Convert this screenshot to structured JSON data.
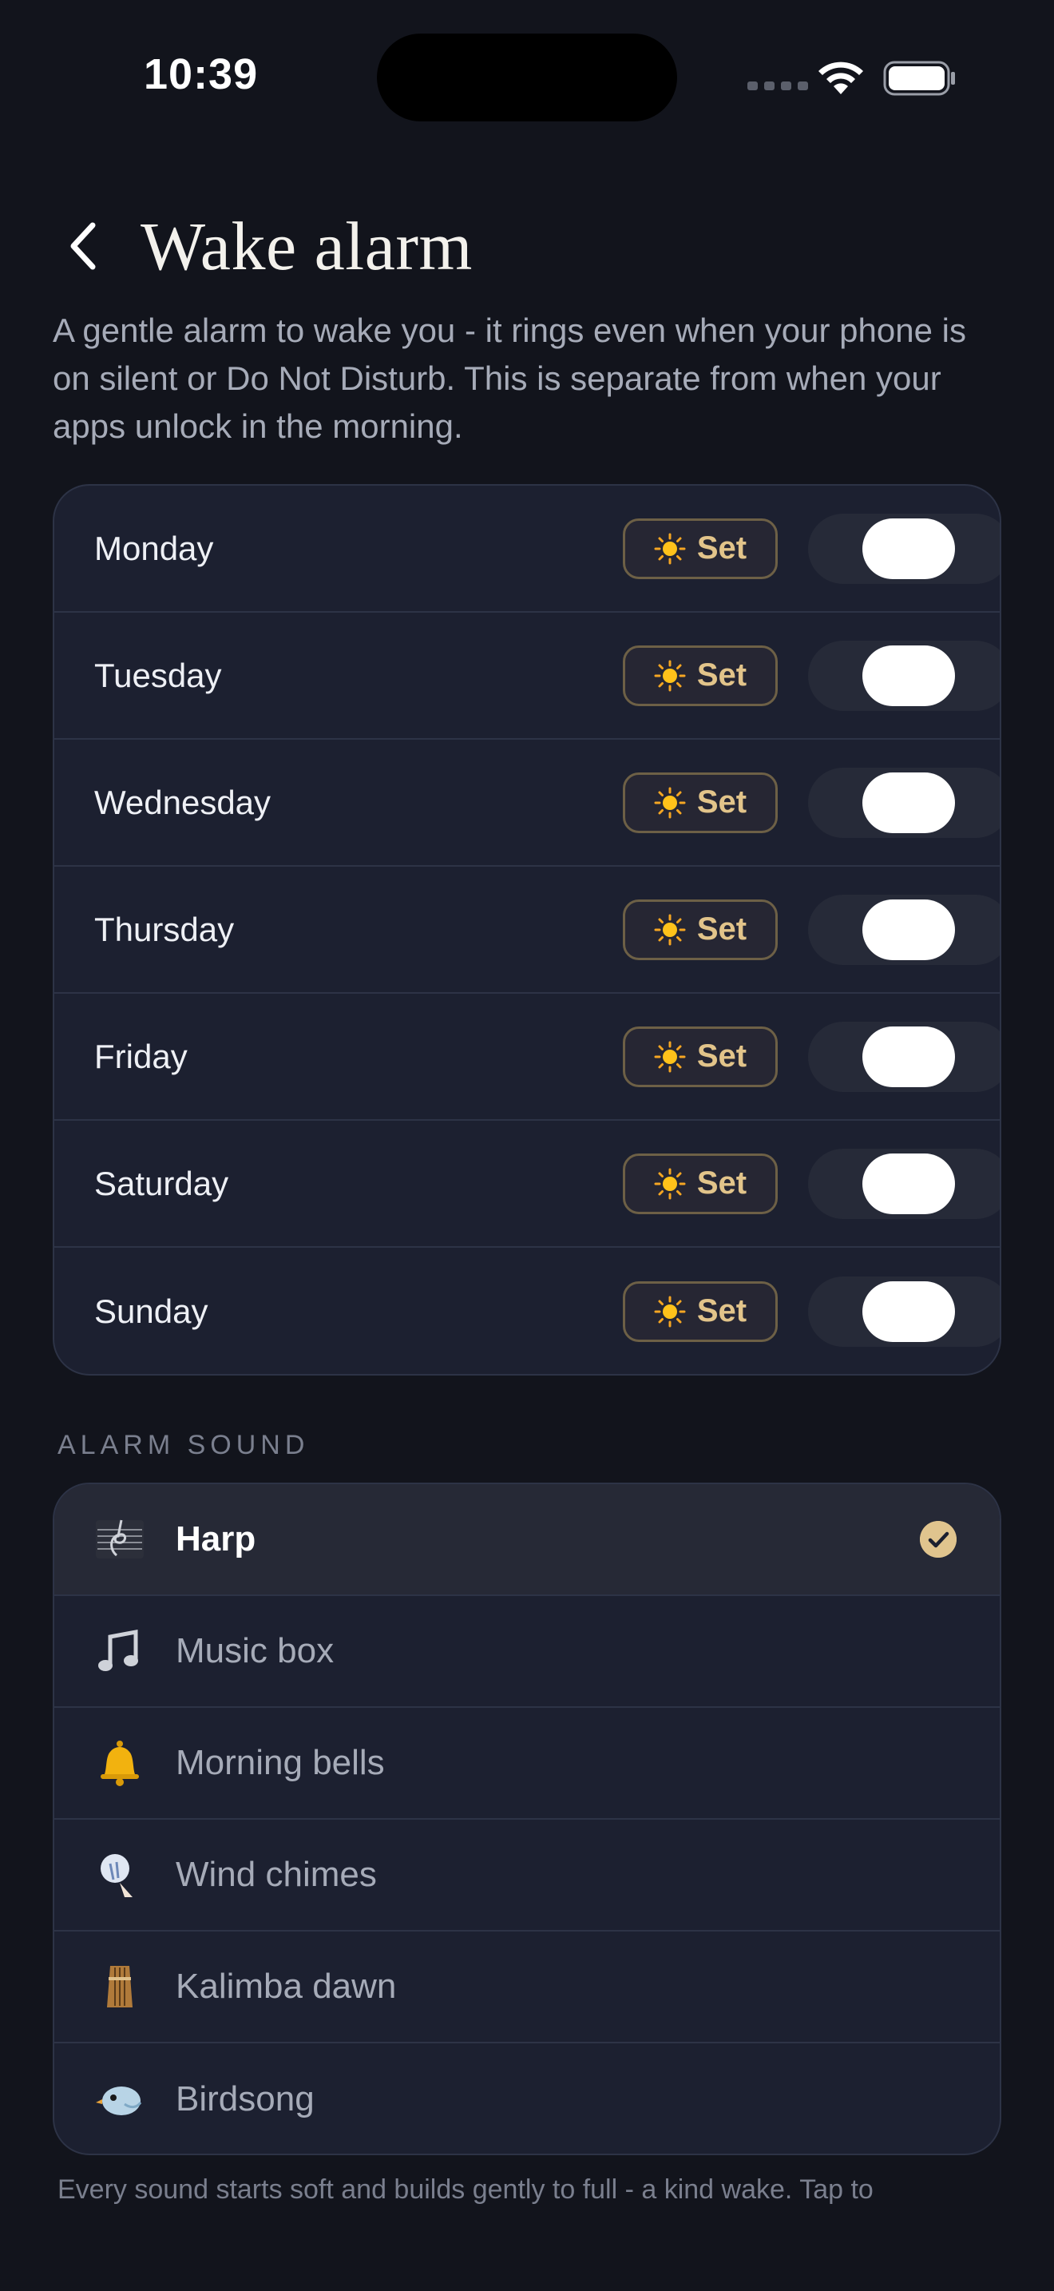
{
  "status_bar": {
    "time": "10:39"
  },
  "header": {
    "title": "Wake alarm"
  },
  "description": "A gentle alarm to wake you - it rings even when your phone is on silent or Do Not Disturb. This is separate from when your apps unlock in the morning.",
  "days": [
    {
      "label": "Monday",
      "set_label": "Set",
      "enabled": false
    },
    {
      "label": "Tuesday",
      "set_label": "Set",
      "enabled": false
    },
    {
      "label": "Wednesday",
      "set_label": "Set",
      "enabled": false
    },
    {
      "label": "Thursday",
      "set_label": "Set",
      "enabled": false
    },
    {
      "label": "Friday",
      "set_label": "Set",
      "enabled": false
    },
    {
      "label": "Saturday",
      "set_label": "Set",
      "enabled": false
    },
    {
      "label": "Sunday",
      "set_label": "Set",
      "enabled": false
    }
  ],
  "alarm_sound": {
    "section_title": "ALARM SOUND",
    "options": [
      {
        "label": "Harp",
        "icon": "harp-icon",
        "selected": true
      },
      {
        "label": "Music box",
        "icon": "music-note-icon",
        "selected": false
      },
      {
        "label": "Morning bells",
        "icon": "bell-icon",
        "selected": false
      },
      {
        "label": "Wind chimes",
        "icon": "wind-chime-icon",
        "selected": false
      },
      {
        "label": "Kalimba dawn",
        "icon": "kalimba-icon",
        "selected": false
      },
      {
        "label": "Birdsong",
        "icon": "bird-icon",
        "selected": false
      }
    ]
  },
  "footer": "Every sound starts soft and builds gently to full - a kind wake. Tap to",
  "colors": {
    "background": "#12141c",
    "card": "#1c2030",
    "accent_gold": "#e2c48a",
    "check": "#e0c48e"
  }
}
